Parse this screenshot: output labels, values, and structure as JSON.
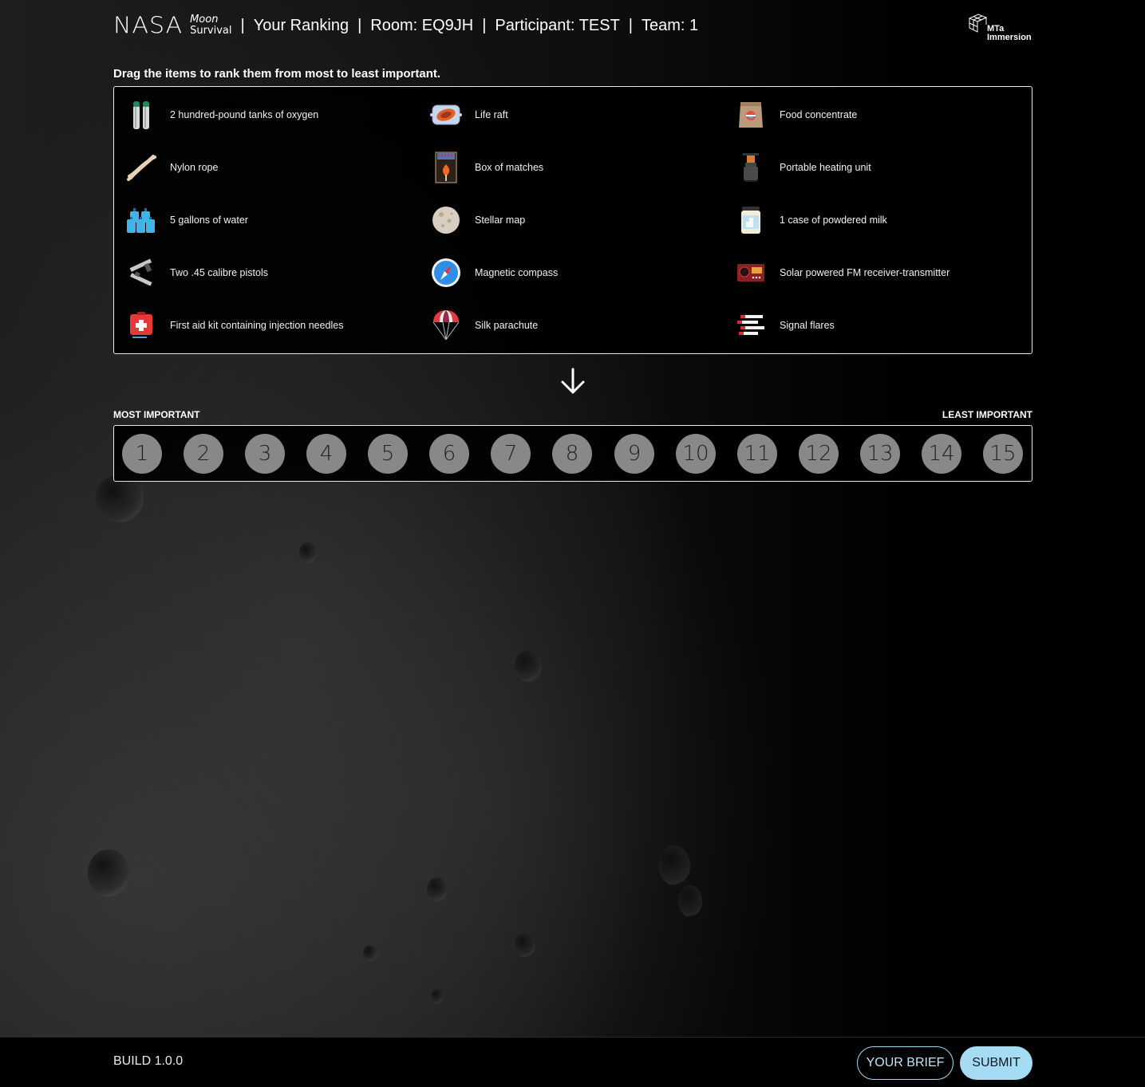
{
  "header": {
    "logo_text": "NASA",
    "logo_sub_line1": "Moon",
    "logo_sub_line2": "Survival",
    "page_name": "Your Ranking",
    "room": "Room: EQ9JH",
    "participant": "Participant: TEST",
    "team": "Team: 1",
    "separator": "|",
    "partner_logo_line1": "MTa",
    "partner_logo_line2": "Immersion"
  },
  "instruction": "Drag the items to rank them from most to least important.",
  "items": [
    {
      "label": "2 hundred-pound tanks of oxygen",
      "icon": "oxygen-tanks-icon"
    },
    {
      "label": "Life raft",
      "icon": "life-raft-icon"
    },
    {
      "label": "Food concentrate",
      "icon": "food-concentrate-icon"
    },
    {
      "label": "Nylon rope",
      "icon": "rope-icon"
    },
    {
      "label": "Box of matches",
      "icon": "matches-icon"
    },
    {
      "label": "Portable heating unit",
      "icon": "heater-icon"
    },
    {
      "label": "5 gallons of water",
      "icon": "water-jugs-icon"
    },
    {
      "label": "Stellar map",
      "icon": "moon-map-icon"
    },
    {
      "label": "1 case of powdered milk",
      "icon": "milk-jar-icon"
    },
    {
      "label": "Two .45 calibre pistols",
      "icon": "pistols-icon"
    },
    {
      "label": "Magnetic compass",
      "icon": "compass-icon"
    },
    {
      "label": "Solar powered FM receiver-transmitter",
      "icon": "radio-icon"
    },
    {
      "label": "First aid kit containing injection needles",
      "icon": "first-aid-kit-icon"
    },
    {
      "label": "Silk parachute",
      "icon": "parachute-icon"
    },
    {
      "label": "Signal flares",
      "icon": "flares-icon"
    }
  ],
  "ranking": {
    "most_label": "MOST IMPORTANT",
    "least_label": "LEAST IMPORTANT",
    "slots": [
      "1",
      "2",
      "3",
      "4",
      "5",
      "6",
      "7",
      "8",
      "9",
      "10",
      "11",
      "12",
      "13",
      "14",
      "15"
    ]
  },
  "footer": {
    "build": "BUILD 1.0.0",
    "brief_button": "YOUR BRIEF",
    "submit_button": "SUBMIT"
  },
  "colors": {
    "accent": "#a6dcf3",
    "slot_fill": "#888888",
    "background": "#000000"
  }
}
